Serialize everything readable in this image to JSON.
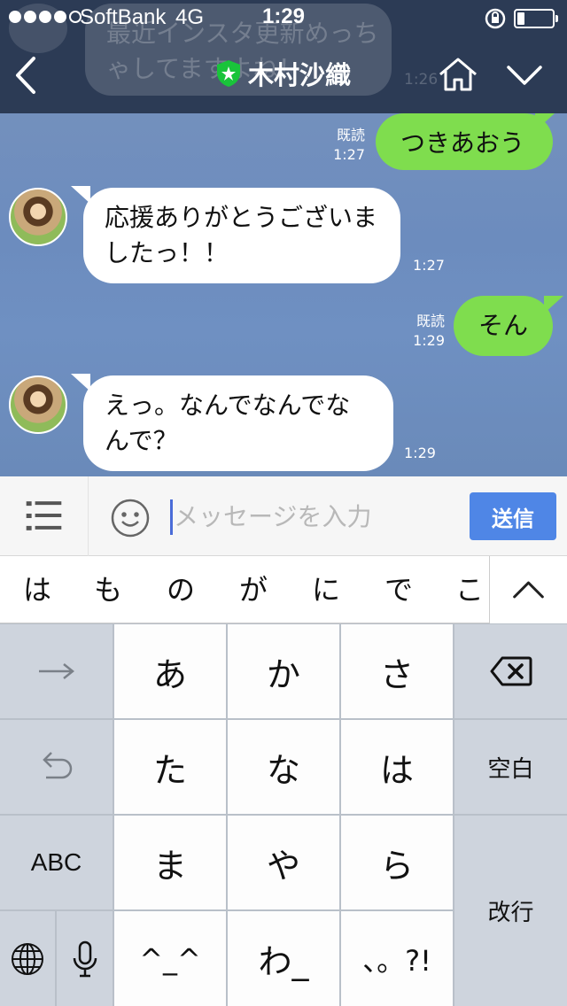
{
  "status_bar": {
    "carrier": "SoftBank",
    "network": "4G",
    "time": "1:29",
    "signal_bars_filled": 4,
    "signal_bars_total": 5,
    "battery_level": 0.22
  },
  "header": {
    "contact_name": "木村沙織",
    "back_icon": "chevron-left-icon",
    "badge_icon": "shield-star-icon",
    "home_icon": "home-icon",
    "menu_icon": "chevron-down-icon",
    "colors": {
      "background": "#2c3b55"
    }
  },
  "ghost_message": {
    "text": "最近インスタ更新めっちゃしてますよね！",
    "time": "1:26"
  },
  "messages": [
    {
      "direction": "out",
      "text": "つきあおう",
      "read_label": "既読",
      "time": "1:27"
    },
    {
      "direction": "in",
      "text": "応援ありがとうございましたっ！！",
      "time": "1:27"
    },
    {
      "direction": "out",
      "text": "そん",
      "read_label": "既読",
      "time": "1:29"
    },
    {
      "direction": "in",
      "text": "えっ。なんでなんでなんで？",
      "time": "1:29"
    }
  ],
  "input_bar": {
    "placeholder": "メッセージを入力",
    "send_label": "送信",
    "menu_icon": "list-icon",
    "emoji_icon": "smiley-icon",
    "colors": {
      "send": "#4f86e6"
    }
  },
  "suggestions": [
    "は",
    "も",
    "の",
    "が",
    "に",
    "で",
    "こ"
  ],
  "keyboard": {
    "keys": {
      "a": "あ",
      "ka": "か",
      "sa": "さ",
      "ta": "た",
      "na": "な",
      "ha": "は",
      "ma": "ま",
      "ya": "や",
      "ra": "ら",
      "kaomoji": "^_^",
      "wa": "わ_",
      "punct": "、。?!",
      "space": "空白",
      "return": "改行",
      "abc": "ABC"
    },
    "icons": [
      "arrow-right-icon",
      "undo-icon",
      "globe-icon",
      "microphone-icon",
      "backspace-icon"
    ]
  },
  "chat_colors": {
    "outgoing": "#7fdd4e",
    "incoming": "#ffffff",
    "background": "#6f8fbf"
  }
}
